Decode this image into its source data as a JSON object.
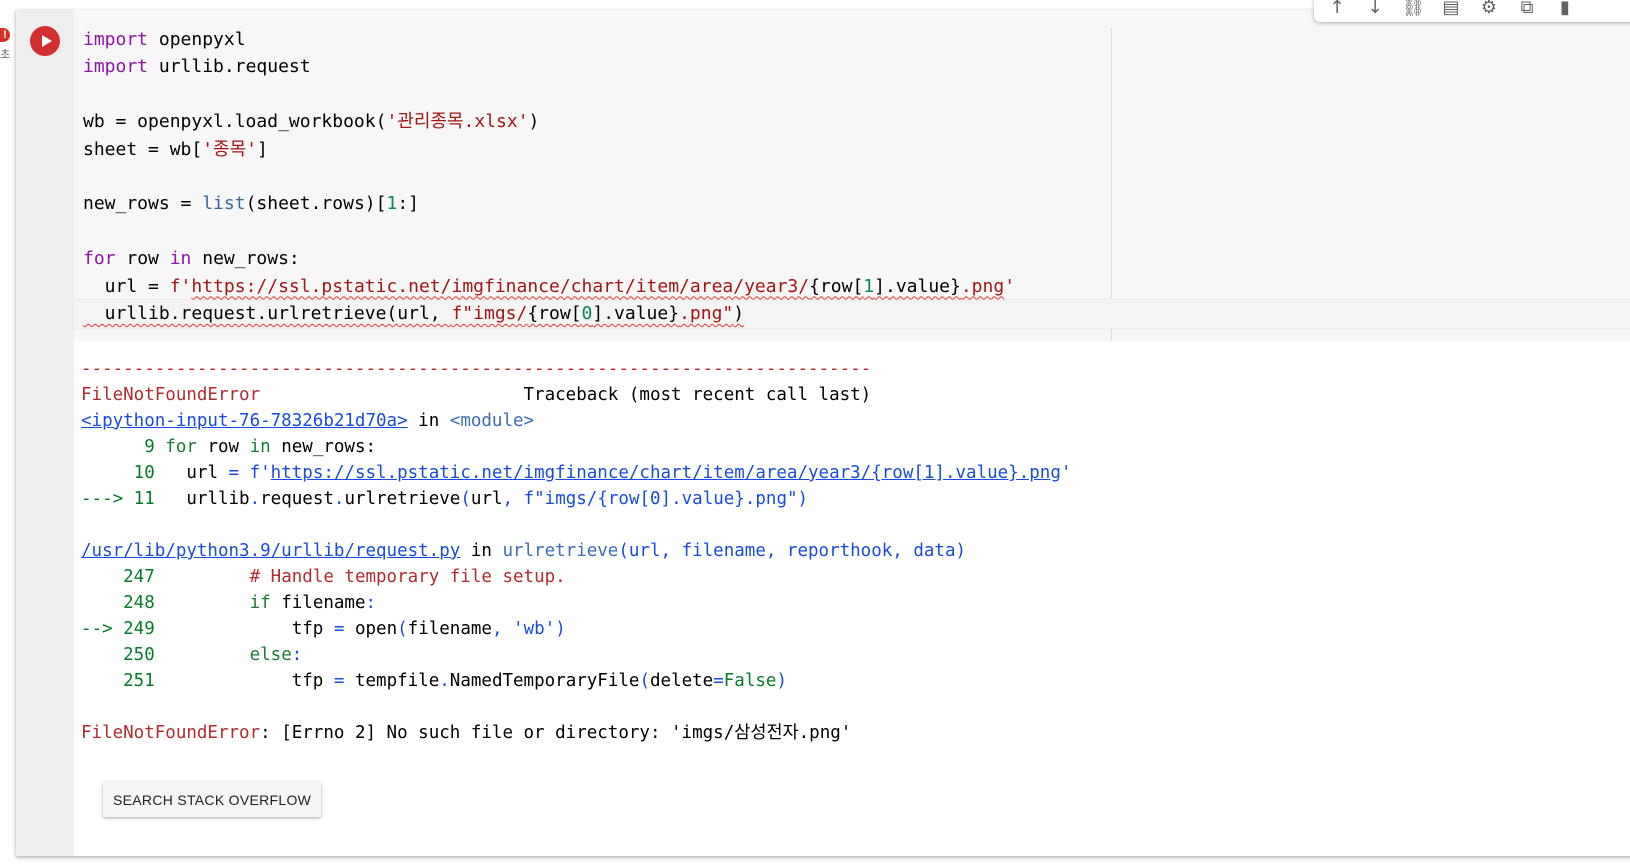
{
  "gutter": {
    "status_badge": "!",
    "status_text": "초"
  },
  "code_lines": [
    [
      {
        "t": "import",
        "c": "kw"
      },
      {
        "t": " openpyxl"
      }
    ],
    [
      {
        "t": "import",
        "c": "kw"
      },
      {
        "t": " urllib.request"
      }
    ],
    [],
    [
      {
        "t": "wb = openpyxl.load_workbook("
      },
      {
        "t": "'관리종목.xlsx'",
        "c": "str"
      },
      {
        "t": ")"
      }
    ],
    [
      {
        "t": "sheet = wb["
      },
      {
        "t": "'종목'",
        "c": "str"
      },
      {
        "t": "]"
      }
    ],
    [],
    [
      {
        "t": "new_rows = "
      },
      {
        "t": "list",
        "c": "bi"
      },
      {
        "t": "(sheet.rows)["
      },
      {
        "t": "1",
        "c": "num"
      },
      {
        "t": ":]"
      }
    ],
    [],
    [
      {
        "t": "for",
        "c": "kw"
      },
      {
        "t": " row "
      },
      {
        "t": "in",
        "c": "kw"
      },
      {
        "t": " new_rows:"
      }
    ],
    [
      {
        "t": "  url = "
      },
      {
        "t": "f'",
        "c": "str"
      },
      {
        "t": "https://ssl.pstatic.net/imgfinance/chart/item/area/year3/",
        "c": "str sq"
      },
      {
        "t": "{row[",
        "c": "sq"
      },
      {
        "t": "1",
        "c": "num sq"
      },
      {
        "t": "].value}",
        "c": "sq"
      },
      {
        "t": ".png",
        "c": "str sq"
      },
      {
        "t": "'",
        "c": "str"
      }
    ],
    [
      {
        "t": "  urllib.request.urlretrieve(url, ",
        "c": "sq"
      },
      {
        "t": "f\"imgs/",
        "c": "str sq"
      },
      {
        "t": "{row[",
        "c": "sq"
      },
      {
        "t": "0",
        "c": "num sq"
      },
      {
        "t": "].value}",
        "c": "sq"
      },
      {
        "t": ".png\"",
        "c": "str sq"
      },
      {
        "t": ")",
        "c": "sq"
      }
    ]
  ],
  "traceback_lines": [
    [
      {
        "t": "---------------------------------------------------------------------------",
        "c": "err"
      }
    ],
    [
      {
        "t": "FileNotFoundError",
        "c": "err"
      },
      {
        "t": "                         Traceback (most recent call last)"
      }
    ],
    [
      {
        "t": "<ipython-input-76-78326b21d70a>",
        "c": "lnk"
      },
      {
        "t": " in "
      },
      {
        "t": "<module>",
        "c": "mod"
      }
    ],
    [
      {
        "t": "      9 ",
        "c": "ln"
      },
      {
        "t": "for",
        "c": "kwg"
      },
      {
        "t": " row "
      },
      {
        "t": "in",
        "c": "kwg"
      },
      {
        "t": " new_rows:"
      }
    ],
    [
      {
        "t": "     10 ",
        "c": "ln"
      },
      {
        "t": "  url "
      },
      {
        "t": "=",
        "c": "op"
      },
      {
        "t": " f'",
        "c": "blue"
      },
      {
        "t": "https://ssl.pstatic.net/imgfinance/chart/item/area/year3/{row[1].value}.png",
        "c": "lnk"
      },
      {
        "t": "'",
        "c": "blue"
      }
    ],
    [
      {
        "t": "---> 11",
        "c": "ln"
      },
      {
        "t": "   urllib"
      },
      {
        "t": ".",
        "c": "op"
      },
      {
        "t": "request"
      },
      {
        "t": ".",
        "c": "op"
      },
      {
        "t": "urlretrieve"
      },
      {
        "t": "(",
        "c": "op"
      },
      {
        "t": "url"
      },
      {
        "t": ", ",
        "c": "op"
      },
      {
        "t": "f\"imgs/{row[0].value}.png\"",
        "c": "blue"
      },
      {
        "t": ")",
        "c": "op"
      }
    ],
    [],
    [
      {
        "t": "/usr/lib/python3.9/urllib/request.py",
        "c": "lnk"
      },
      {
        "t": " in "
      },
      {
        "t": "urlretrieve",
        "c": "mod"
      },
      {
        "t": "(url, filename, reporthook, data)",
        "c": "blue"
      }
    ],
    [
      {
        "t": "    247 ",
        "c": "ln"
      },
      {
        "t": "        "
      },
      {
        "t": "# Handle temporary file setup.",
        "c": "cm"
      }
    ],
    [
      {
        "t": "    248 ",
        "c": "ln"
      },
      {
        "t": "        "
      },
      {
        "t": "if",
        "c": "kwg"
      },
      {
        "t": " filename"
      },
      {
        "t": ":",
        "c": "op"
      }
    ],
    [
      {
        "t": "--> 249 ",
        "c": "ln"
      },
      {
        "t": "            tfp "
      },
      {
        "t": "=",
        "c": "op"
      },
      {
        "t": " open"
      },
      {
        "t": "(",
        "c": "op"
      },
      {
        "t": "filename"
      },
      {
        "t": ", ",
        "c": "op"
      },
      {
        "t": "'wb'",
        "c": "blue"
      },
      {
        "t": ")",
        "c": "op"
      }
    ],
    [
      {
        "t": "    250 ",
        "c": "ln"
      },
      {
        "t": "        "
      },
      {
        "t": "else",
        "c": "kwg"
      },
      {
        "t": ":",
        "c": "op"
      }
    ],
    [
      {
        "t": "    251 ",
        "c": "ln"
      },
      {
        "t": "            tfp "
      },
      {
        "t": "=",
        "c": "op"
      },
      {
        "t": " tempfile"
      },
      {
        "t": ".",
        "c": "op"
      },
      {
        "t": "NamedTemporaryFile"
      },
      {
        "t": "(",
        "c": "op"
      },
      {
        "t": "delete"
      },
      {
        "t": "=",
        "c": "op"
      },
      {
        "t": "False",
        "c": "g"
      },
      {
        "t": ")",
        "c": "op"
      }
    ],
    [],
    [
      {
        "t": "FileNotFoundError",
        "c": "err"
      },
      {
        "t": ": [Errno 2] No such file or directory: 'imgs/삼성전자.png'"
      }
    ]
  ],
  "buttons": {
    "search_stack_overflow": "SEARCH STACK OVERFLOW"
  },
  "toolbar": [
    {
      "name": "move-up-icon",
      "glyph": "↑"
    },
    {
      "name": "move-down-icon",
      "glyph": "↓"
    },
    {
      "name": "link-icon",
      "glyph": "⛓"
    },
    {
      "name": "comment-icon",
      "glyph": "▤"
    },
    {
      "name": "gear-icon",
      "glyph": "⚙"
    },
    {
      "name": "mirror-cell-icon",
      "glyph": "⧉"
    },
    {
      "name": "delete-icon",
      "glyph": "▮"
    }
  ]
}
